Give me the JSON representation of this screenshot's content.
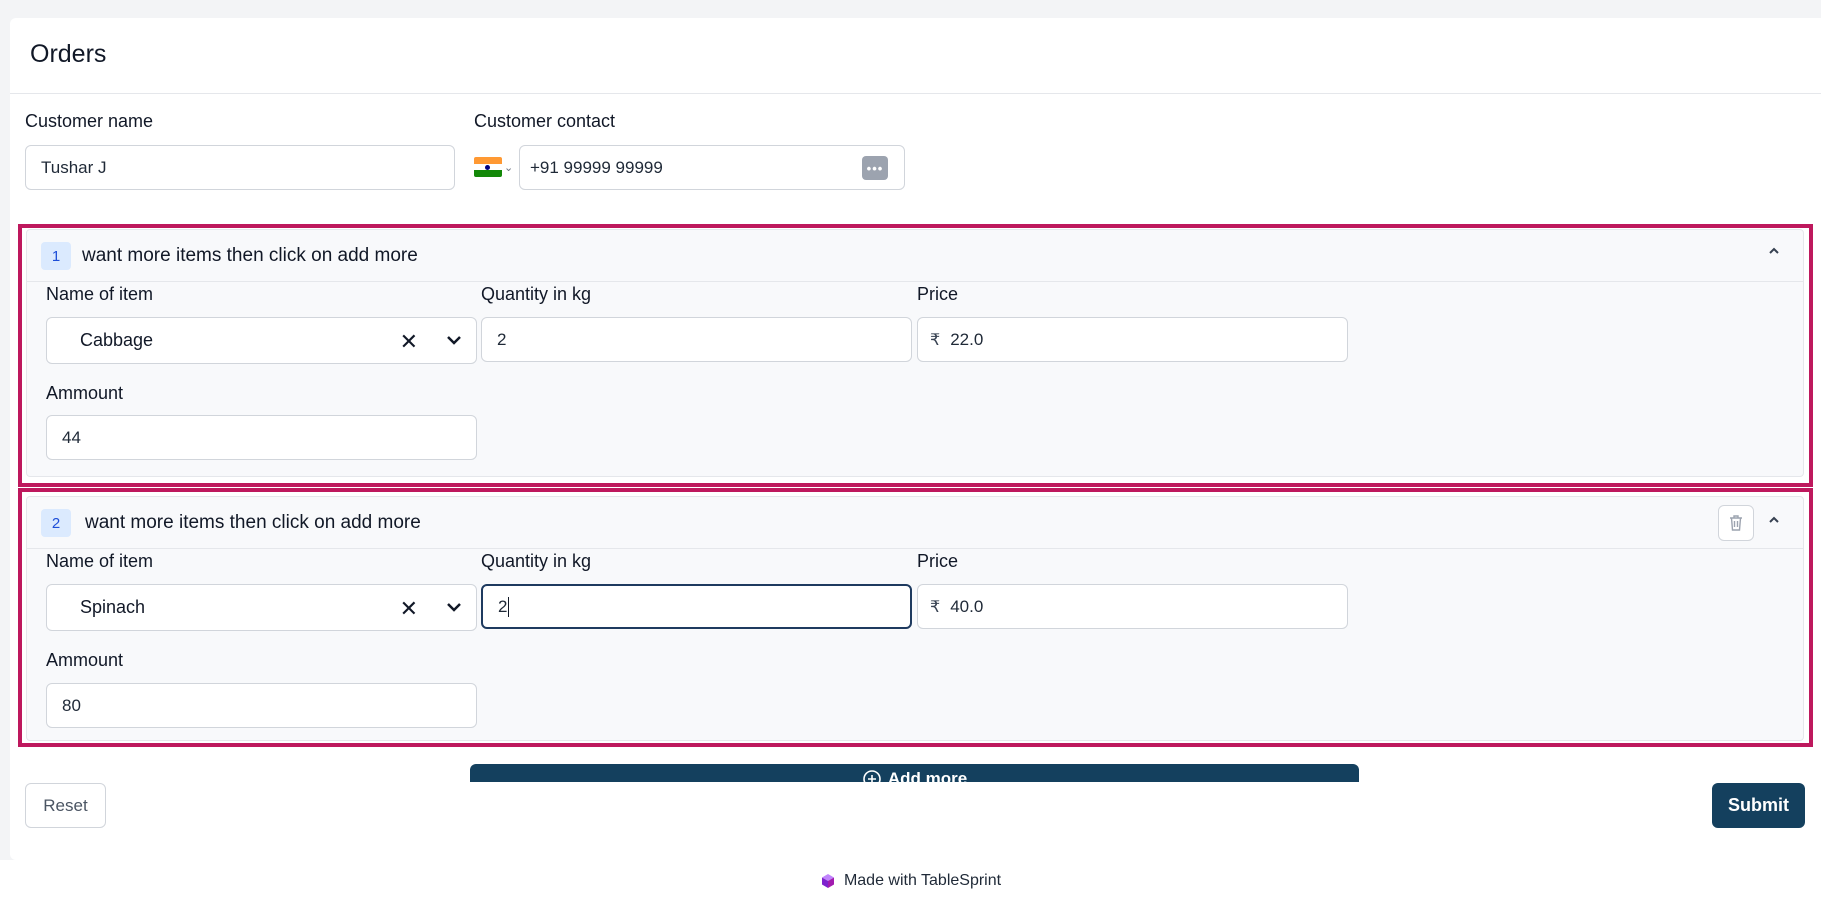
{
  "page": {
    "title": "Orders"
  },
  "customer": {
    "name_label": "Customer name",
    "name_value": "Tushar J",
    "contact_label": "Customer contact",
    "contact_value": "+91 99999 99999"
  },
  "items": [
    {
      "index": "1",
      "header": "want more items then click on add more",
      "item_label": "Name of item",
      "item_value": "Cabbage",
      "qty_label": "Quantity in kg",
      "qty_value": "2",
      "price_label": "Price",
      "currency": "₹",
      "price_value": "22.0",
      "amount_label": "Ammount",
      "amount_value": "44"
    },
    {
      "index": "2",
      "header": "want more items then click on add more",
      "item_label": "Name of item",
      "item_value": "Spinach",
      "qty_label": "Quantity in kg",
      "qty_value": "2",
      "price_label": "Price",
      "currency": "₹",
      "price_value": "40.0",
      "amount_label": "Ammount",
      "amount_value": "80"
    }
  ],
  "actions": {
    "add_more": "Add more",
    "reset": "Reset",
    "submit": "Submit"
  },
  "footer": {
    "text": "Made with TableSprint"
  },
  "colors": {
    "primary": "#14405e",
    "highlight": "#be185d",
    "badge_bg": "#dbeafe"
  }
}
